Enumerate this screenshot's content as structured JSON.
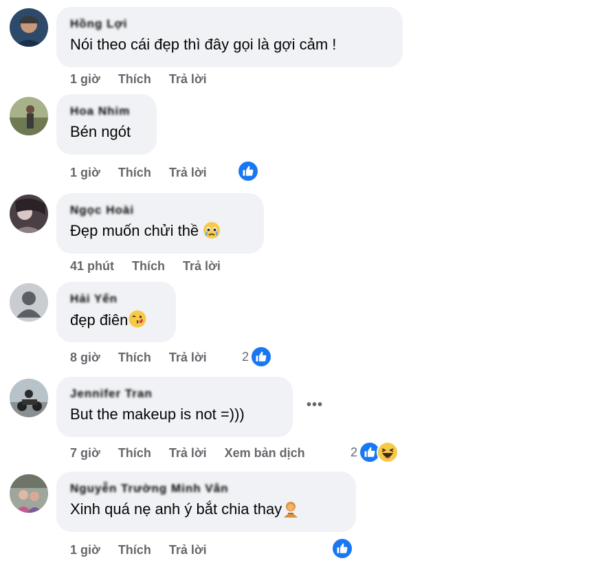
{
  "comments": [
    {
      "name": "Hồng Lợi",
      "text": "Nói theo cái đẹp thì đây gọi là gợi cảm !",
      "time": "1 giờ",
      "like": "Thích",
      "reply": "Trả lời"
    },
    {
      "name": "Hoa Nhim",
      "text": "Bén ngót",
      "time": "1 giờ",
      "like": "Thích",
      "reply": "Trả lời",
      "reactions": {
        "count": "",
        "icons": [
          "like-icon"
        ]
      }
    },
    {
      "name": "Ngọc Hoài",
      "text": "Đẹp muốn chửi thề",
      "emoji": "crying-face-emoji",
      "time": "41 phút",
      "like": "Thích",
      "reply": "Trả lời"
    },
    {
      "name": "Hải Yến",
      "text": "đẹp điên",
      "emoji": "kissing-face-emoji",
      "time": "8 giờ",
      "like": "Thích",
      "reply": "Trả lời",
      "reactions": {
        "count": "2",
        "icons": [
          "like-icon"
        ]
      }
    },
    {
      "name": "Jennifer Tran",
      "text": "But the makeup is not =)))",
      "time": "7 giờ",
      "like": "Thích",
      "reply": "Trả lời",
      "translate": "Xem bản dịch",
      "reactions": {
        "count": "2",
        "icons": [
          "like-icon",
          "haha-icon"
        ]
      },
      "more": "•••"
    },
    {
      "name": "Nguyễn Trường Minh Vân",
      "text": "Xinh quá nẹ anh ý bắt chia thay",
      "emoji": "person-emoji",
      "time": "1 giờ",
      "like": "Thích",
      "reply": "Trả lời",
      "reactions": {
        "count": "",
        "icons": [
          "like-icon"
        ]
      }
    }
  ],
  "colors": {
    "bubble": "#f0f2f5",
    "meta": "#65676b",
    "like": "#1877f2"
  }
}
